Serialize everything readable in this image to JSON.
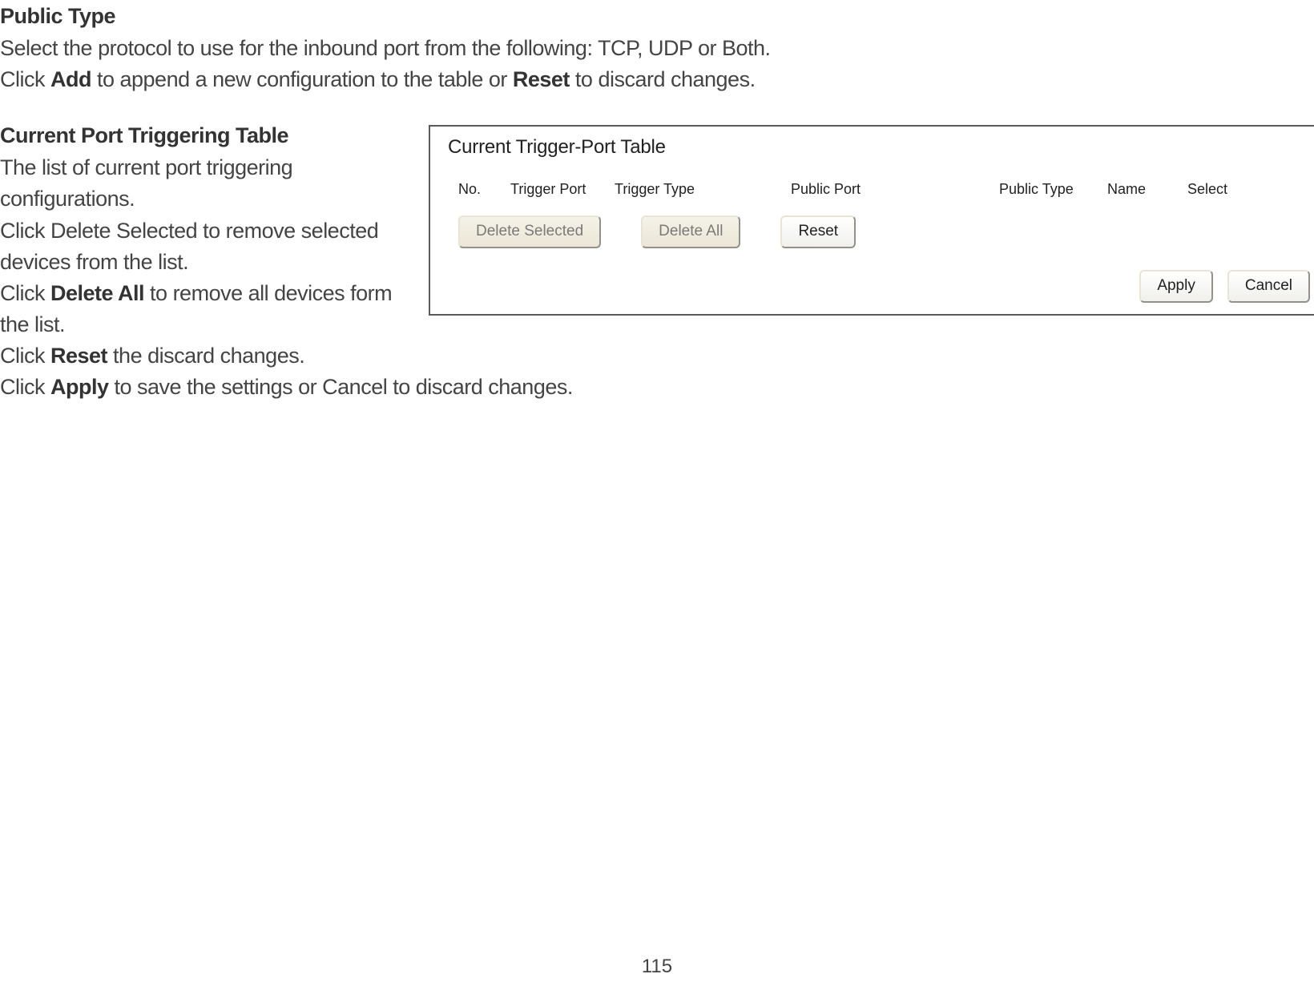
{
  "section1": {
    "heading": "Public Type",
    "line1": "Select the protocol to use for the inbound port from the following: TCP, UDP or Both.",
    "line2_pre": "Click ",
    "line2_add": "Add",
    "line2_mid": " to append a new configuration to the table or ",
    "line2_reset": "Reset",
    "line2_post": " to discard changes."
  },
  "section2": {
    "heading": "Current Port Triggering Table",
    "line1": "The list of current port triggering configurations.",
    "line2": "Click Delete Selected to remove selected devices from the list.",
    "line3_pre": "Click ",
    "line3_bold": "Delete All",
    "line3_post": " to remove all devices form the list.",
    "line4_pre": "Click ",
    "line4_bold": "Reset",
    "line4_post": " the discard changes.",
    "line5_pre": "Click ",
    "line5_bold": "Apply",
    "line5_post": " to save the settings or Cancel to discard changes."
  },
  "panel": {
    "title": "Current Trigger-Port Table",
    "columns": {
      "no": "No.",
      "trigger_port": "Trigger Port",
      "trigger_type": "Trigger Type",
      "public_port": "Public Port",
      "public_type": "Public Type",
      "name": "Name",
      "select": "Select"
    },
    "buttons": {
      "delete_selected": "Delete Selected",
      "delete_all": "Delete All",
      "reset": "Reset",
      "apply": "Apply",
      "cancel": "Cancel"
    }
  },
  "page_number": "115"
}
